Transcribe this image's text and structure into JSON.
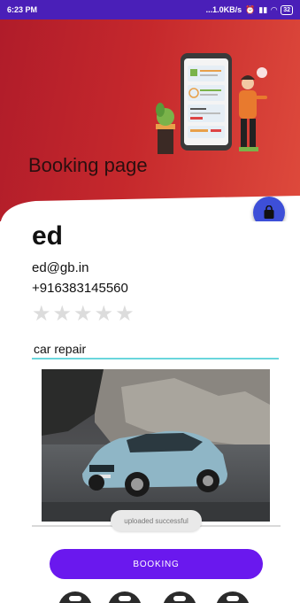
{
  "status_bar": {
    "time": "6:23 PM",
    "speed": "...1.0KB/s",
    "battery": "32"
  },
  "header": {
    "title": "Booking page"
  },
  "profile": {
    "name": "ed",
    "email": "ed@gb.in",
    "phone": "+916383145560",
    "rating": {
      "filled": 0,
      "max": 5
    }
  },
  "service": {
    "value": "car repair"
  },
  "toast": {
    "message": "uploaded successful"
  },
  "booking_button": {
    "label": "BOOKING"
  },
  "bottom_nav": {
    "icons": [
      "home-icon",
      "search-icon",
      "calendar-icon",
      "profile-icon"
    ]
  },
  "colors": {
    "status_bar": "#4a1fb8",
    "header_start": "#b01c2a",
    "header_end": "#de4a3c",
    "fab": "#3d4fd8",
    "button": "#6a18ee",
    "input_underline": "#6ad6dc"
  }
}
